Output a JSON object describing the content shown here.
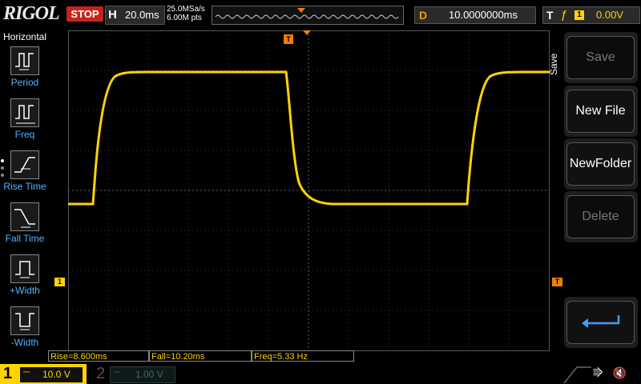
{
  "brand": "RIGOL",
  "run_state": "STOP",
  "timebase": {
    "label": "H",
    "value": "20.0ms"
  },
  "acquisition": {
    "sample_rate": "25.0MSa/s",
    "memory_depth": "6.00M pts"
  },
  "delay": {
    "label": "D",
    "value": "10.0000000ms"
  },
  "trigger": {
    "label": "T",
    "source": "1",
    "level": "0.00V"
  },
  "left_menu": {
    "title": "Horizontal",
    "items": [
      {
        "label": "Period",
        "icon": "period-icon"
      },
      {
        "label": "Freq",
        "icon": "freq-icon"
      },
      {
        "label": "Rise Time",
        "icon": "rise-time-icon"
      },
      {
        "label": "Fall Time",
        "icon": "fall-time-icon"
      },
      {
        "label": "+Width",
        "icon": "positive-width-icon"
      },
      {
        "label": "-Width",
        "icon": "negative-width-icon"
      }
    ]
  },
  "right_menu": {
    "title": "Save",
    "items": [
      {
        "label": "Save",
        "enabled": false
      },
      {
        "label": "New File",
        "enabled": true
      },
      {
        "label": "NewFolder",
        "enabled": true
      },
      {
        "label": "Delete",
        "enabled": false
      }
    ],
    "return_icon": "return-arrow-icon"
  },
  "measurements": [
    {
      "text": "Rise=8.600ms"
    },
    {
      "text": "Fall=10.20ms"
    },
    {
      "text": "Freq=5.33 Hz"
    }
  ],
  "channels": [
    {
      "number": "1",
      "scale": "10.0 V",
      "active": true
    },
    {
      "number": "2",
      "scale": "1.00 V",
      "active": false
    }
  ],
  "markers": {
    "ch1": "1",
    "trigger": "T"
  },
  "colors": {
    "ch1": "#ffd400",
    "trigger": "#f08000",
    "stop": "#c5241c",
    "menu_label": "#4fb4ff"
  }
}
